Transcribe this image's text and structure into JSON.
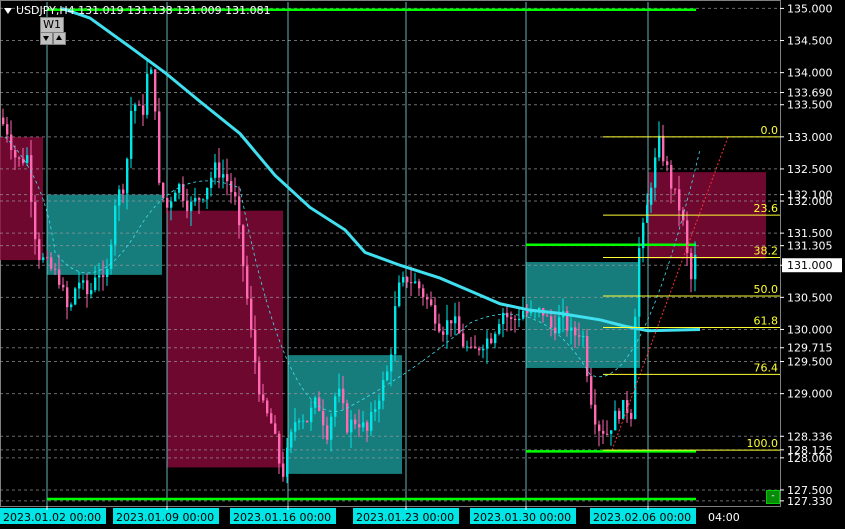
{
  "header": {
    "symbol_line": "USDJPY,H4  131.019 131.138 131.009 131.081"
  },
  "timeframe": {
    "label": "W1"
  },
  "colors": {
    "background": "#000000",
    "bull": "#00e5e5",
    "bear": "#ff69b4",
    "ma": "#40e0f0",
    "fib": "#ffff33",
    "green_line": "#00ff00",
    "zone_teal": "#1fa5a5",
    "zone_maroon": "#8a0a3a",
    "axis_text": "#ffffff",
    "time_label_bg": "#00e5e5"
  },
  "price_axis": {
    "min": 127.25,
    "max": 135.1,
    "labels": [
      "135.000",
      "134.500",
      "134.000",
      "133.690",
      "133.500",
      "133.000",
      "132.500",
      "132.100",
      "132.000",
      "131.500",
      "131.305",
      "131.000",
      "130.500",
      "130.000",
      "129.715",
      "129.500",
      "129.000",
      "128.336",
      "128.125",
      "128.000",
      "127.500",
      "127.330"
    ],
    "highlighted": [
      "131.000"
    ]
  },
  "time_axis": {
    "labels": [
      "2023.01.02 00:00",
      "2023.01.09 00:00",
      "2023.01.16 00:00",
      "2023.01.23 00:00",
      "2023.01.30 00:00",
      "2023.02.06 00:00"
    ],
    "trailing_label": "04:00"
  },
  "fibonacci": {
    "levels": [
      {
        "label": "0.0",
        "price": 133.0
      },
      {
        "label": "23.6",
        "price": 131.78
      },
      {
        "label": "38.2",
        "price": 131.12
      },
      {
        "label": "50.0",
        "price": 130.52
      },
      {
        "label": "61.8",
        "price": 130.03
      },
      {
        "label": "76.4",
        "price": 129.3
      },
      {
        "label": "100.0",
        "price": 128.12
      }
    ]
  },
  "horizontal_lines": [
    {
      "price": 134.98,
      "name": "upper-green-line"
    },
    {
      "price": 127.36,
      "name": "lower-green-line"
    },
    {
      "price": 131.32,
      "name": "zone-top-green-line"
    },
    {
      "price": 128.1,
      "name": "zone-bottom-green-line"
    }
  ],
  "zones": [
    {
      "type": "maroon",
      "p1": 133.0,
      "p2": 131.08,
      "name": "zone-week-1-maroon"
    },
    {
      "type": "teal",
      "p1": 132.1,
      "p2": 130.85,
      "name": "zone-week-2-teal"
    },
    {
      "type": "maroon",
      "p1": 131.85,
      "p2": 127.85,
      "name": "zone-week-3-maroon"
    },
    {
      "type": "teal",
      "p1": 129.6,
      "p2": 127.75,
      "name": "zone-week-4-teal"
    },
    {
      "type": "teal",
      "p1": 131.05,
      "p2": 129.4,
      "name": "zone-week-5-teal"
    },
    {
      "type": "maroon",
      "p1": 132.45,
      "p2": 131.1,
      "name": "zone-week-6-maroon"
    }
  ],
  "fib_labels_title": ""
}
